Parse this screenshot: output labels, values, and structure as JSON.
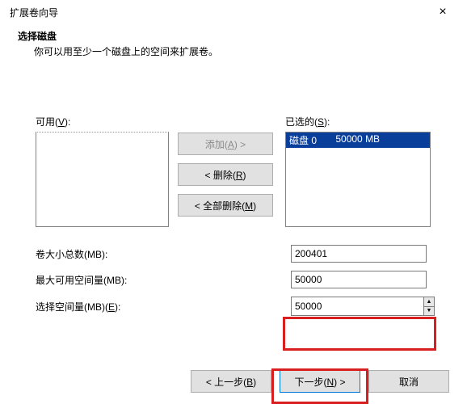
{
  "window": {
    "title": "扩展卷向导",
    "heading": "选择磁盘",
    "subheading": "你可以用至少一个磁盘上的空间来扩展卷。"
  },
  "labels": {
    "available": "可用(V):",
    "selected": "已选的(S):"
  },
  "buttons": {
    "add": "添加(A) >",
    "remove": "< 删除(R)",
    "remove_all": "< 全部删除(M)",
    "back": "< 上一步(B)",
    "next": "下一步(N) >",
    "cancel": "取消"
  },
  "selected_list": [
    {
      "name": "磁盘 0",
      "size": "50000 MB"
    }
  ],
  "fields": {
    "total_label": "卷大小总数(MB):",
    "total_value": "200401",
    "max_label": "最大可用空间量(MB):",
    "max_value": "50000",
    "select_label": "选择空间量(MB)(E):",
    "select_value": "50000"
  }
}
